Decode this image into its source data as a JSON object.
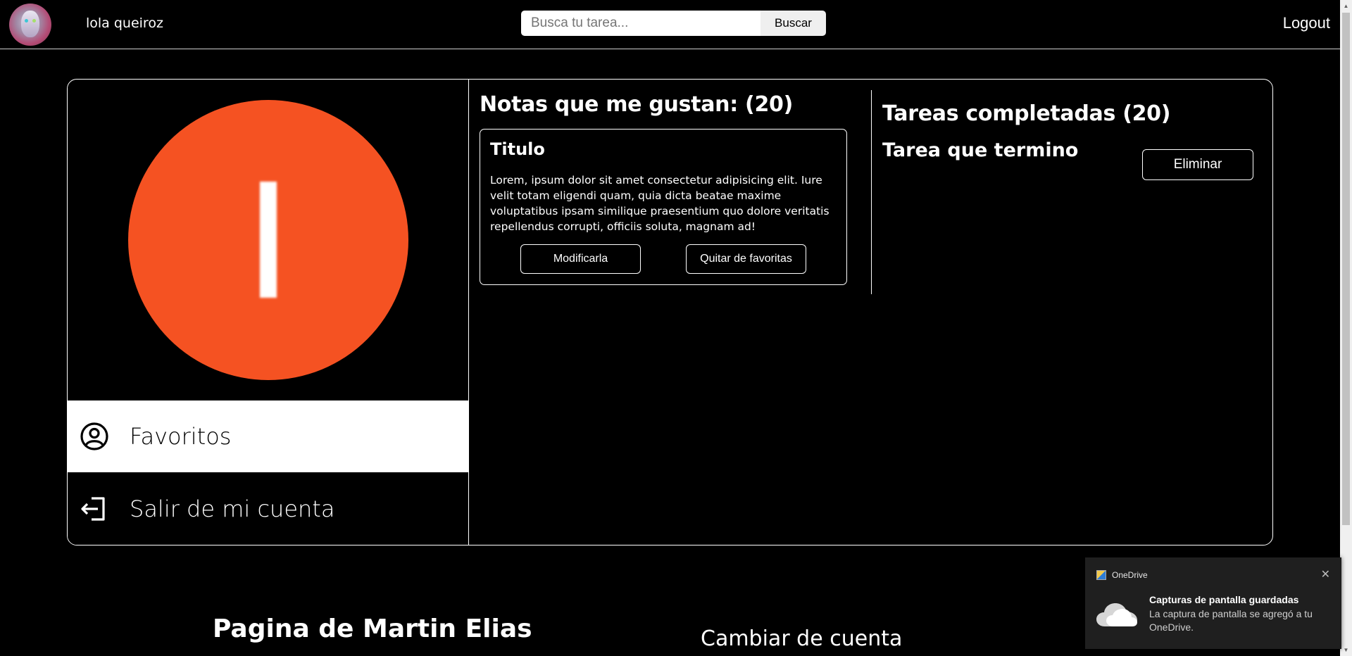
{
  "header": {
    "username": "lola queiroz",
    "search": {
      "placeholder": "Busca tu tarea...",
      "value": ""
    },
    "search_button": "Buscar",
    "logout": "Logout"
  },
  "profile": {
    "avatar_letter_color": "#ffffff",
    "avatar_bg": "#f55222"
  },
  "menu": {
    "favorites": "Favoritos",
    "sign_out": "Salir de mi cuenta"
  },
  "liked_notes": {
    "heading": "Notas que me gustan: (20)",
    "note": {
      "title": "Titulo",
      "body": "Lorem, ipsum dolor sit amet consectetur adipisicing elit. Iure velit totam eligendi quam, quia dicta beatae maxime voluptatibus ipsam similique praesentium quo dolore veritatis repellendus corrupti, officiis soluta, magnam ad!",
      "modify_button": "Modificarla",
      "unfavorite_button": "Quitar de favoritas"
    }
  },
  "completed_tasks": {
    "heading": "Tareas completadas (20)",
    "task_title": "Tarea que termino",
    "delete_button": "Eliminar"
  },
  "footer": {
    "page_owner": "Pagina de Martin Elias",
    "switch_account": "Cambiar de cuenta"
  },
  "toast": {
    "app": "OneDrive",
    "title": "Capturas de pantalla guardadas",
    "body": "La captura de pantalla se agregó a tu OneDrive.",
    "close_icon": "close-icon"
  }
}
